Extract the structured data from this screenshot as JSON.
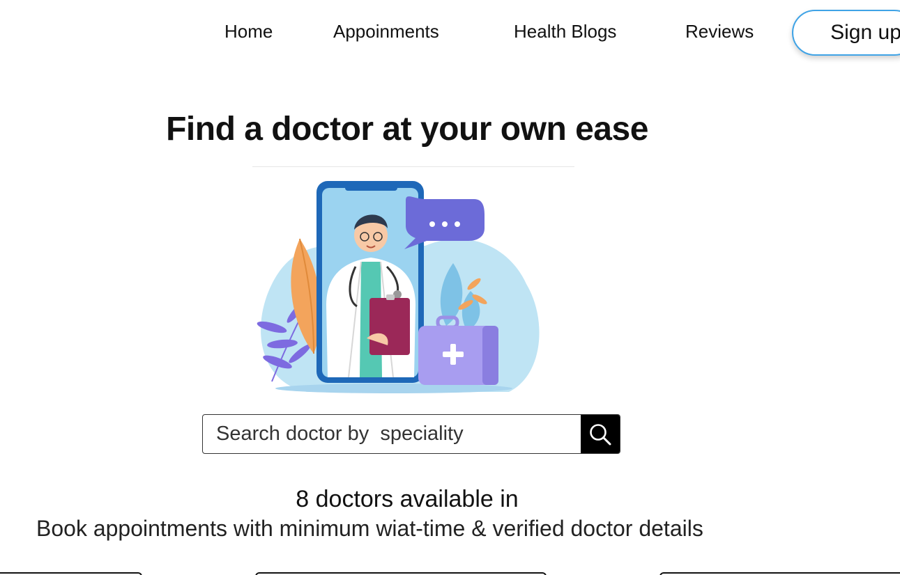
{
  "nav": {
    "items": [
      {
        "label": "Home"
      },
      {
        "label": "Appoinments"
      },
      {
        "label": "Health Blogs"
      },
      {
        "label": "Reviews"
      }
    ],
    "signup_label": "Sign up"
  },
  "hero": {
    "title": "Find a doctor at your own ease"
  },
  "illustration": {
    "description_icon": "doctor-phone-illustration"
  },
  "search": {
    "placeholder": "Search doctor by  speciality",
    "value": "",
    "button_icon": "search-icon"
  },
  "availability": {
    "count_text": "8 doctors available in",
    "subtitle": "Book appointments with minimum wiat-time & verified doctor details"
  },
  "colors": {
    "signup_border": "#3fa3e6",
    "search_button": "#000000"
  }
}
